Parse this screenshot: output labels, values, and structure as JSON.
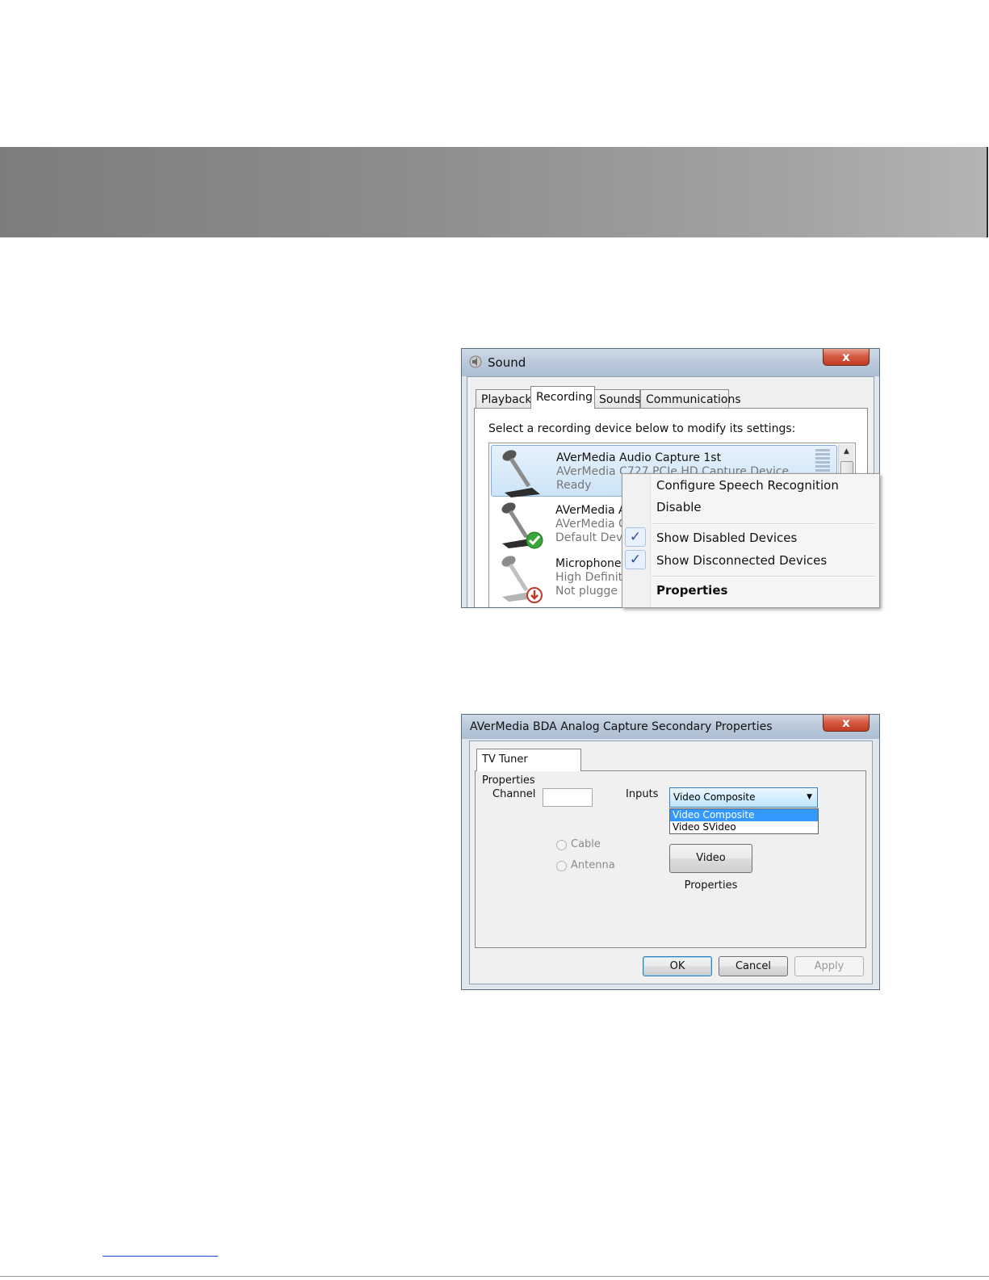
{
  "sound_window": {
    "title": "Sound",
    "close_label": "x",
    "tabs": [
      {
        "label": "Playback"
      },
      {
        "label": "Recording"
      },
      {
        "label": "Sounds"
      },
      {
        "label": "Communications"
      }
    ],
    "instruction": "Select a recording device below to modify its settings:",
    "devices": [
      {
        "name": "AVerMedia Audio Capture 1st",
        "description": "AVerMedia C727 PCIe HD Capture Device",
        "status": "Ready",
        "icon": "microphone-icon"
      },
      {
        "name": "AVerMedia A",
        "description": "AVerMedia C",
        "status": "Default Dev",
        "icon": "microphone-default-icon"
      },
      {
        "name": "Microphone",
        "description": "High Definit",
        "status": "Not plugge",
        "icon": "microphone-unplugged-icon"
      }
    ],
    "context_menu": {
      "items": [
        {
          "label": "Configure Speech Recognition"
        },
        {
          "label": "Disable"
        },
        {
          "label": "Show Disabled Devices",
          "checked": true
        },
        {
          "label": "Show Disconnected Devices",
          "checked": true
        },
        {
          "label": "Properties"
        }
      ],
      "check_glyph": "✓"
    }
  },
  "properties_window": {
    "title": "AVerMedia BDA Analog Capture Secondary Properties",
    "close_label": "x",
    "tab_label": "TV Tuner Properties",
    "channel_label": "Channel",
    "channel_value": "",
    "inputs_label": "Inputs",
    "inputs_selected": "Video Composite",
    "inputs_options": [
      "Video Composite",
      "Video SVideo"
    ],
    "cable_label": "Cable",
    "antenna_label": "Antenna",
    "video_properties_label": "Video Properties",
    "ok_label": "OK",
    "cancel_label": "Cancel",
    "apply_label": "Apply"
  },
  "colors": {
    "selection_blue": "#3399ff",
    "close_red": "#c13b22",
    "check_blue": "#2d4ea1"
  }
}
